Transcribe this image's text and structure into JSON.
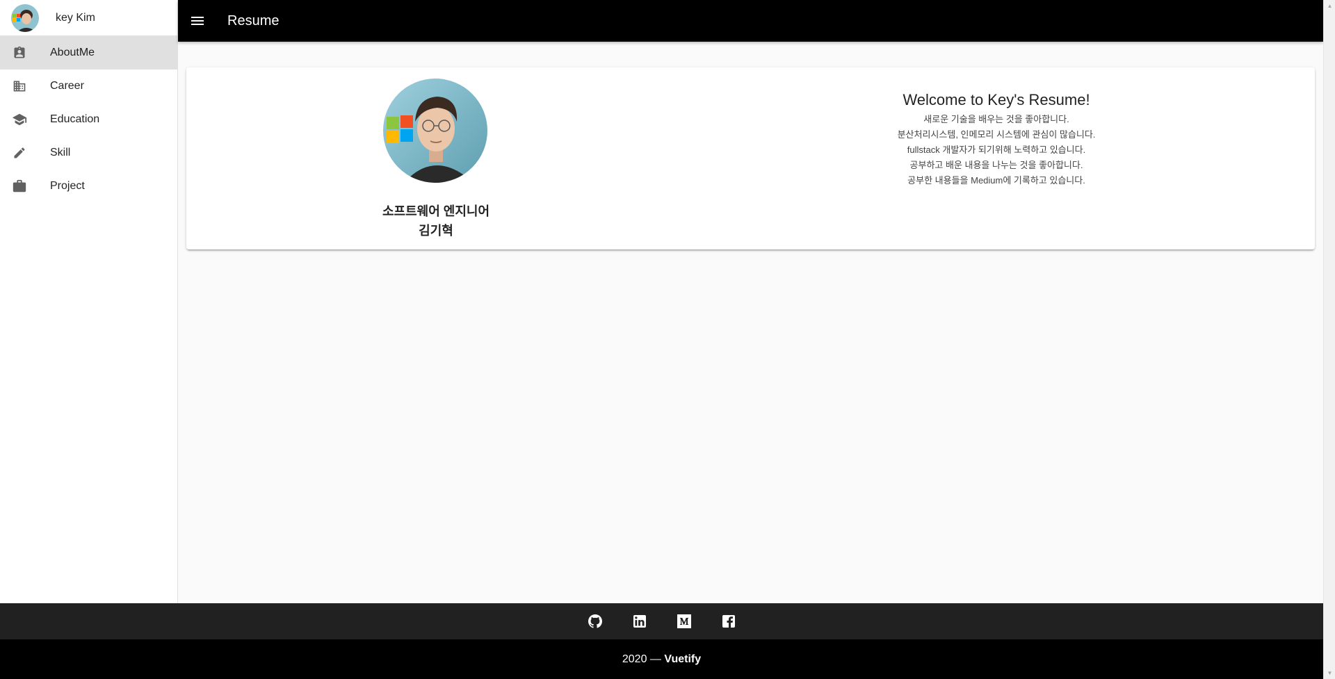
{
  "app": {
    "title": "Resume"
  },
  "profile": {
    "name": "key Kim"
  },
  "nav": {
    "items": [
      {
        "label": "AboutMe",
        "icon": "account-box-icon"
      },
      {
        "label": "Career",
        "icon": "domain-icon"
      },
      {
        "label": "Education",
        "icon": "school-icon"
      },
      {
        "label": "Skill",
        "icon": "pencil-icon"
      },
      {
        "label": "Project",
        "icon": "briefcase-icon"
      }
    ],
    "active": "AboutMe"
  },
  "about": {
    "job_title": "소프트웨어 엔지니어",
    "name": "김기혁",
    "welcome": "Welcome to Key's Resume!",
    "intro": [
      "새로운 기술을 배우는 것을 좋아합니다.",
      "분산처리시스템, 인메모리 시스템에 관심이 많습니다.",
      "fullstack 개발자가 되기위해 노력하고 있습니다.",
      "공부하고 배운 내용을 나누는 것을 좋아합니다.",
      "공부한 내용들을 Medium에 기록하고 있습니다."
    ]
  },
  "footer": {
    "social_icons": [
      "github-icon",
      "linkedin-icon",
      "medium-icon",
      "facebook-icon"
    ],
    "year": "2020",
    "separator": " — ",
    "brand": "Vuetify"
  },
  "colors": {
    "appbar": "#000000",
    "footer_top": "#212121",
    "footer_bottom": "#000000",
    "active_nav": "#e0e0e0",
    "background": "#fafafa"
  }
}
